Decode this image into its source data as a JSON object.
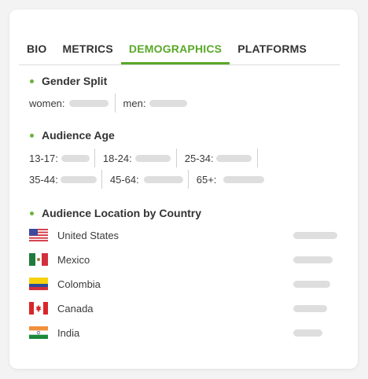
{
  "tabs": [
    {
      "label": "BIO",
      "active": false
    },
    {
      "label": "METRICS",
      "active": false
    },
    {
      "label": "DEMOGRAPHICS",
      "active": true
    },
    {
      "label": "PLATFORMS",
      "active": false
    }
  ],
  "accent_color": "#5aa829",
  "gender": {
    "title": "Gender Split",
    "women_label": "women:",
    "men_label": "men:"
  },
  "age": {
    "title": "Audience Age",
    "buckets": [
      "13-17:",
      "18-24:",
      "25-34:",
      "35-44:",
      "45-64:",
      "65+:"
    ]
  },
  "location": {
    "title": "Audience Location by Country",
    "countries": [
      {
        "name": "United States",
        "flag_icon": "us-flag-icon"
      },
      {
        "name": "Mexico",
        "flag_icon": "mexico-flag-icon"
      },
      {
        "name": "Colombia",
        "flag_icon": "colombia-flag-icon"
      },
      {
        "name": "Canada",
        "flag_icon": "canada-flag-icon"
      },
      {
        "name": "India",
        "flag_icon": "india-flag-icon"
      }
    ]
  }
}
